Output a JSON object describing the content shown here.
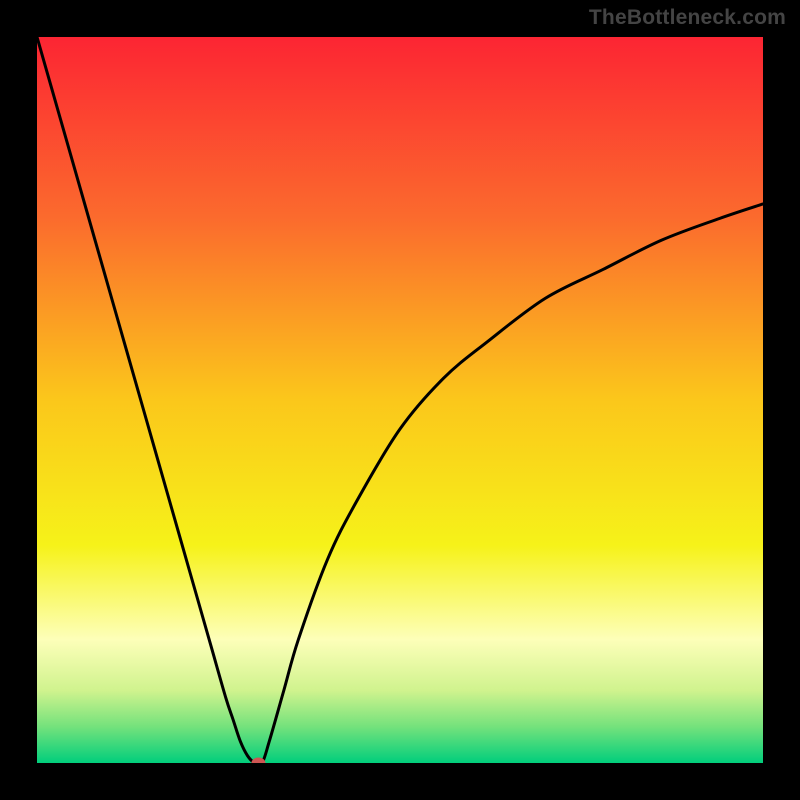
{
  "watermark": {
    "text": "TheBottleneck.com"
  },
  "chart_data": {
    "type": "line",
    "title": "",
    "xlabel": "",
    "ylabel": "",
    "x": [
      0,
      2,
      4,
      6,
      8,
      10,
      12,
      14,
      16,
      18,
      20,
      22,
      24,
      26,
      27,
      28,
      29,
      30,
      31,
      32,
      34,
      36,
      40,
      44,
      50,
      56,
      62,
      70,
      78,
      86,
      94,
      100
    ],
    "values": [
      100,
      93,
      86,
      79,
      72,
      65,
      58,
      51,
      44,
      37,
      30,
      23,
      16,
      9,
      6,
      3,
      1,
      0,
      0,
      3,
      10,
      17,
      28,
      36,
      46,
      53,
      58,
      64,
      68,
      72,
      75,
      77
    ],
    "marker": {
      "x": 30.5,
      "y": 0
    },
    "xlim": [
      0,
      100
    ],
    "ylim": [
      0,
      100
    ],
    "gradient_stops": [
      {
        "pos": 0.0,
        "color": "#fc2533"
      },
      {
        "pos": 0.25,
        "color": "#fb6b2d"
      },
      {
        "pos": 0.5,
        "color": "#fbc71b"
      },
      {
        "pos": 0.7,
        "color": "#f6f219"
      },
      {
        "pos": 0.83,
        "color": "#fdffb9"
      },
      {
        "pos": 0.9,
        "color": "#d0f38e"
      },
      {
        "pos": 0.95,
        "color": "#74e27c"
      },
      {
        "pos": 1.0,
        "color": "#01ce7c"
      }
    ],
    "curve_color": "#000000",
    "marker_color": "#cd5653"
  }
}
